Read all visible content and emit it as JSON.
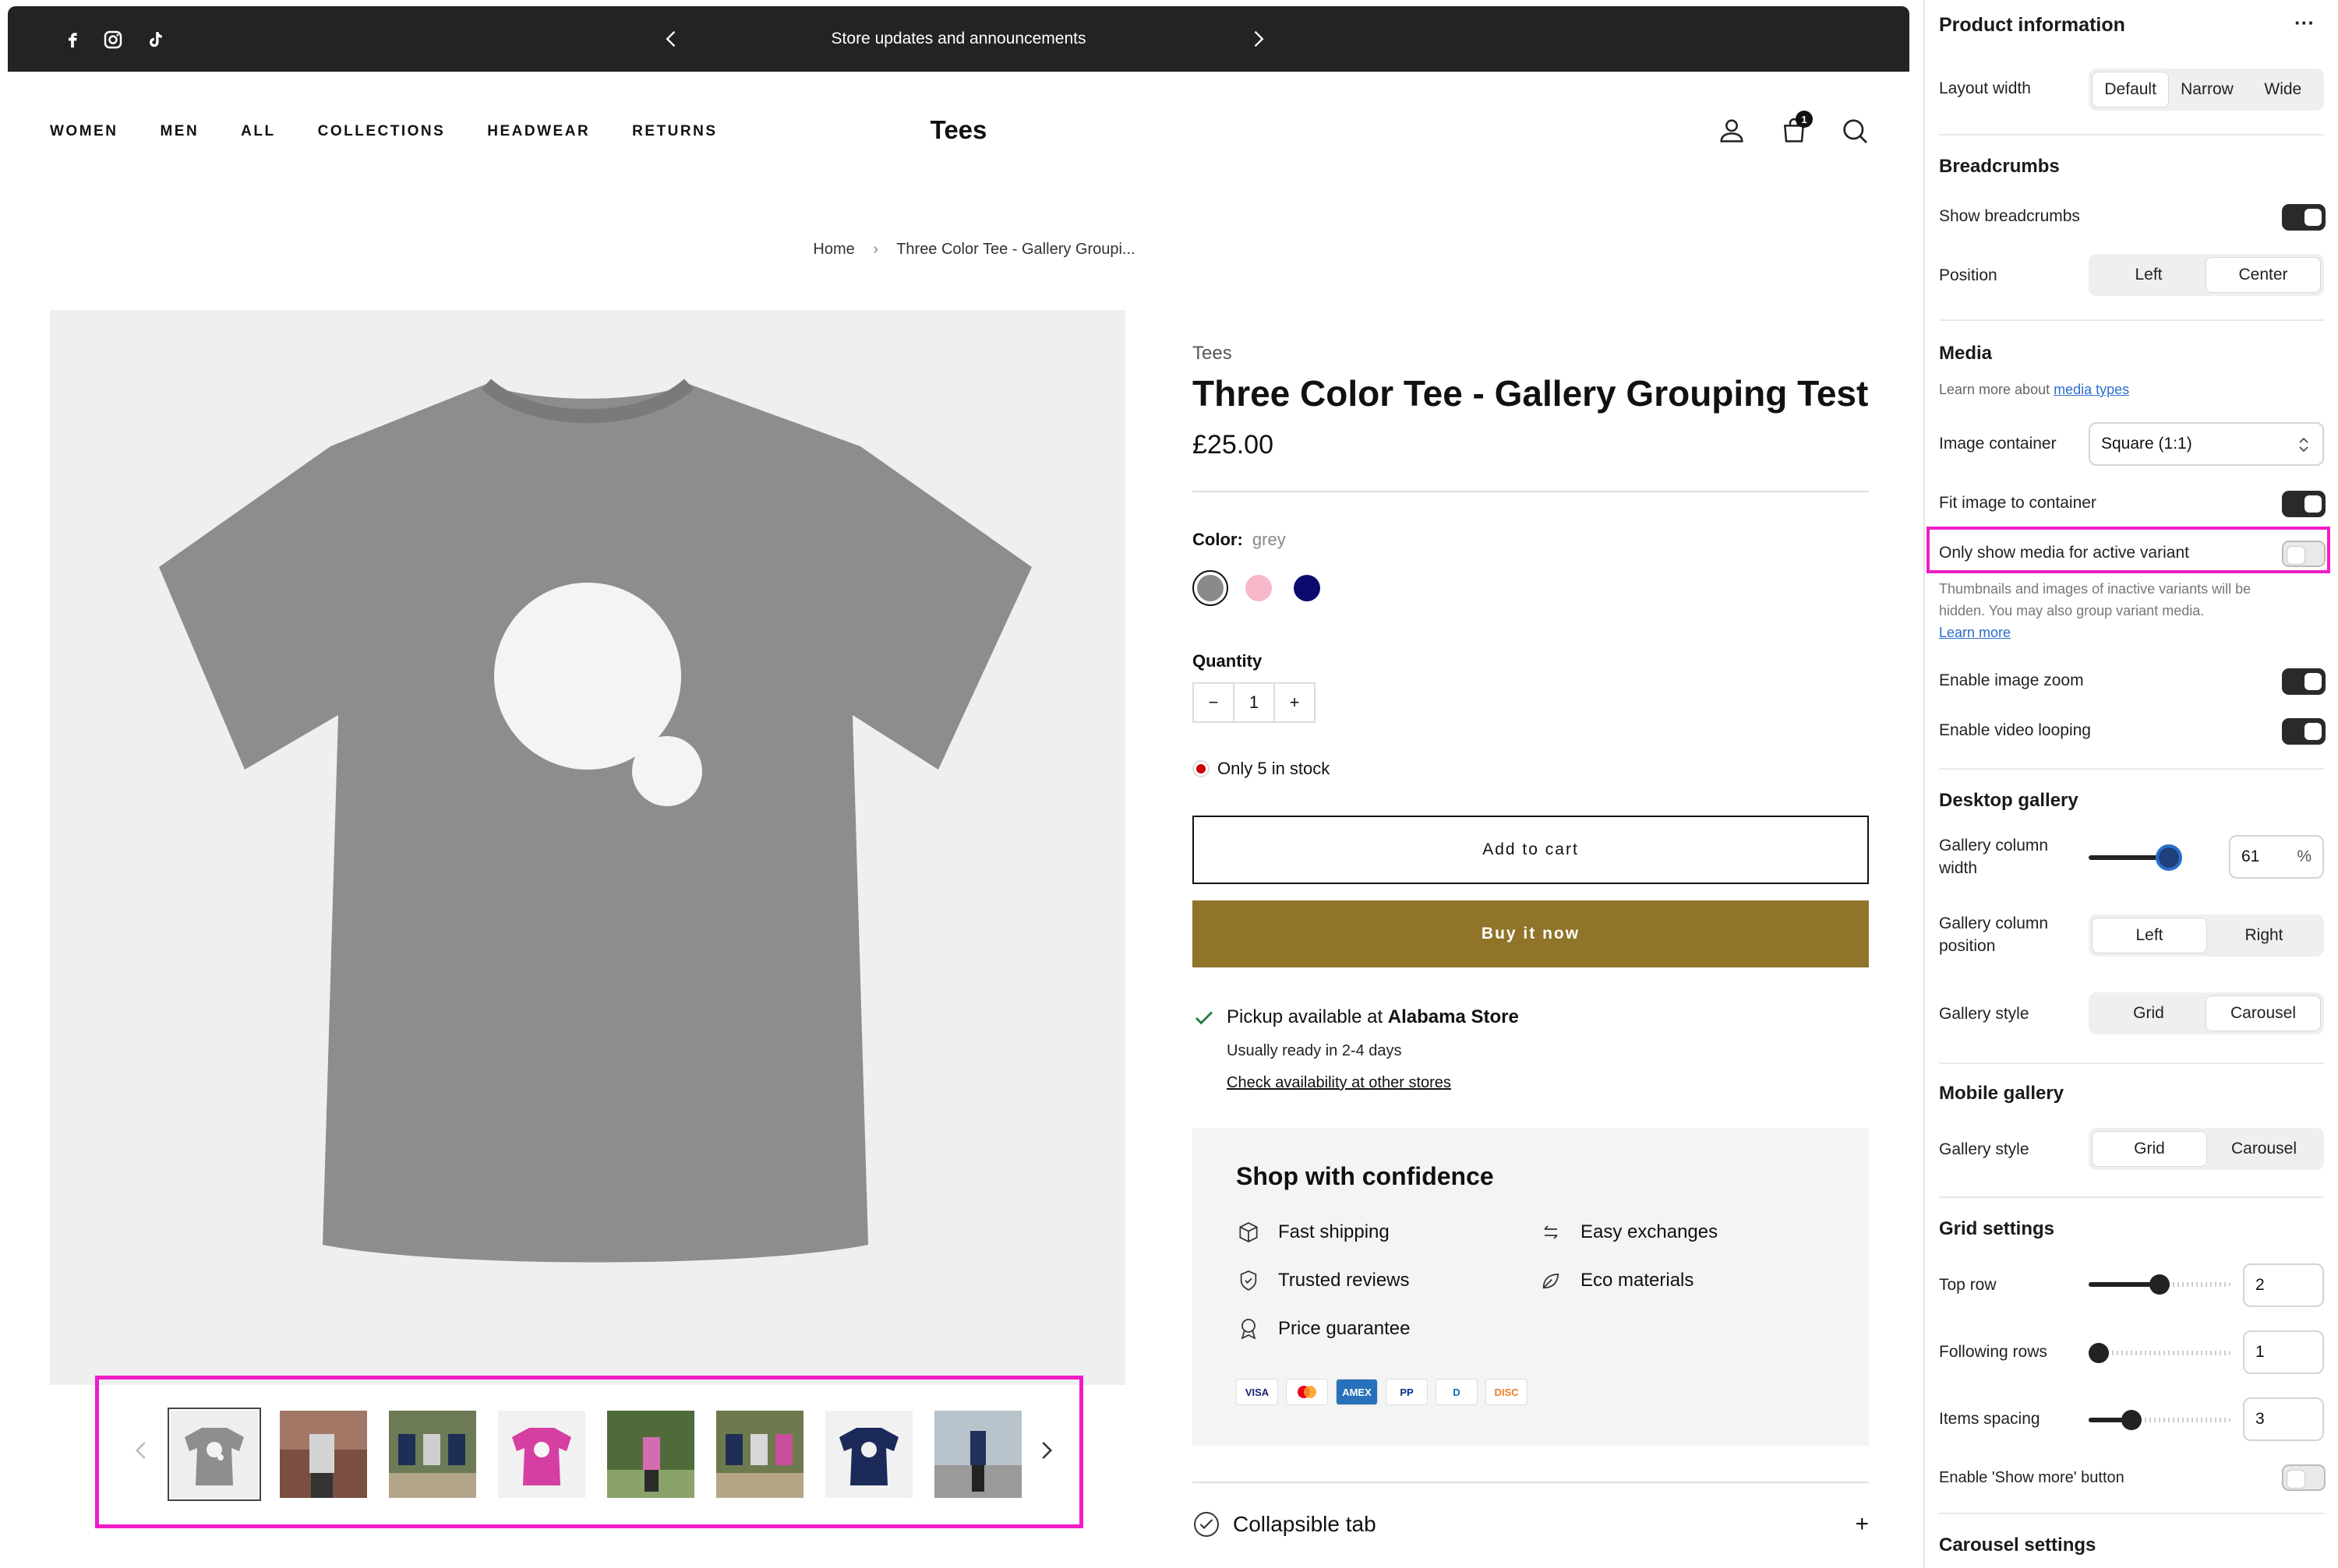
{
  "announcement": {
    "text": "Store updates and announcements"
  },
  "nav": {
    "items": [
      "WOMEN",
      "MEN",
      "ALL",
      "COLLECTIONS",
      "HEADWEAR",
      "RETURNS"
    ]
  },
  "brand": "Tees",
  "cart": {
    "count": "1"
  },
  "breadcrumb": {
    "home": "Home",
    "current": "Three Color Tee - Gallery Groupi..."
  },
  "product": {
    "vendor": "Tees",
    "title": "Three Color Tee - Gallery Grouping Test",
    "price": "£25.00",
    "color_label": "Color:",
    "color_value": "grey",
    "swatches": [
      "#8a8a8a",
      "#f7b8c9",
      "#0b0b6e"
    ],
    "quantity_label": "Quantity",
    "quantity": "1",
    "minus": "−",
    "plus": "+",
    "stock": "Only 5 in stock",
    "add_to_cart": "Add to cart",
    "buy_now": "Buy it now",
    "pickup_prefix": "Pickup available at ",
    "pickup_store": "Alabama Store",
    "pickup_ready": "Usually ready in 2-4 days",
    "pickup_link": "Check availability at other stores"
  },
  "confidence": {
    "title": "Shop with confidence",
    "features": [
      "Fast shipping",
      "Easy exchanges",
      "Trusted reviews",
      "Eco materials",
      "Price guarantee"
    ],
    "payments": [
      "VISA",
      "MC",
      "AMEX",
      "PP",
      "D",
      "DISC"
    ]
  },
  "collapsible": {
    "label": "Collapsible tab",
    "icon": "+"
  },
  "panel": {
    "title": "Product information",
    "more": "···",
    "layout_width": {
      "label": "Layout width",
      "options": [
        "Default",
        "Narrow",
        "Wide"
      ],
      "selected": 0
    },
    "breadcrumbs": {
      "heading": "Breadcrumbs",
      "show_label": "Show breadcrumbs",
      "position_label": "Position",
      "position_options": [
        "Left",
        "Center"
      ],
      "position_selected": 1
    },
    "media": {
      "heading": "Media",
      "learn_prefix": "Learn more about ",
      "learn_link": "media types",
      "image_container_label": "Image container",
      "image_container_value": "Square (1:1)",
      "fit_label": "Fit image to container",
      "only_active_label": "Only show media for active variant",
      "help_line1": "Thumbnails and images of inactive variants will be",
      "help_line2": "hidden. You may also group variant media.",
      "help_link": "Learn more",
      "zoom_label": "Enable image zoom",
      "loop_label": "Enable video looping"
    },
    "desktop_gallery": {
      "heading": "Desktop gallery",
      "width_label_1": "Gallery column",
      "width_label_2": "width",
      "width_value": "61",
      "width_unit": "%",
      "width_fraction": 0.61,
      "position_label_1": "Gallery column",
      "position_label_2": "position",
      "position_options": [
        "Left",
        "Right"
      ],
      "position_selected": 0,
      "style_label": "Gallery style",
      "style_options": [
        "Grid",
        "Carousel"
      ],
      "style_selected": 1
    },
    "mobile_gallery": {
      "heading": "Mobile gallery",
      "style_label": "Gallery style",
      "style_options": [
        "Grid",
        "Carousel"
      ],
      "style_selected": 0
    },
    "grid_settings": {
      "heading": "Grid settings",
      "top_row_label": "Top row",
      "top_row_value": "2",
      "top_row_fraction": 0.5,
      "following_label": "Following rows",
      "following_value": "1",
      "following_fraction": 0.0,
      "spacing_label": "Items spacing",
      "spacing_value": "3",
      "spacing_fraction": 0.3,
      "show_more_label": "Enable 'Show more' button"
    },
    "carousel_heading": "Carousel settings"
  },
  "colors": {
    "accent_highlight": "#f01cc8",
    "buy_button": "#8f7429",
    "slider_active": "#2c6ecb"
  }
}
